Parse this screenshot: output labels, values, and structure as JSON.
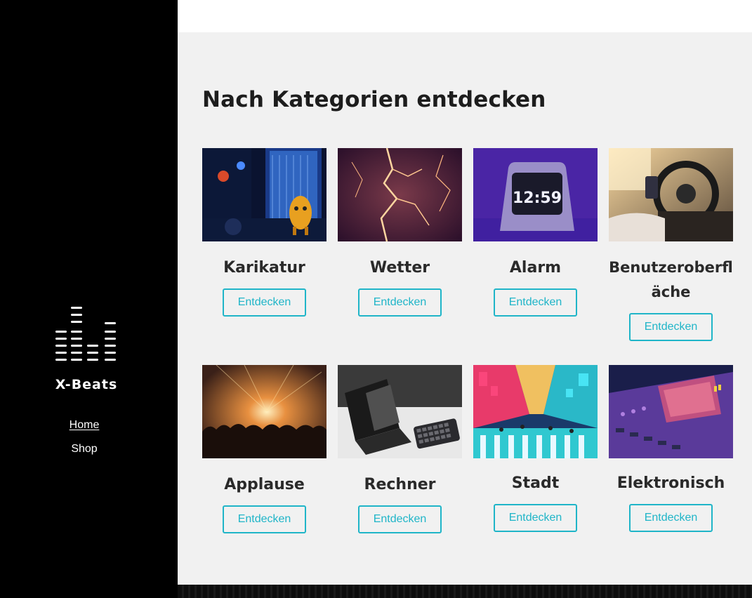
{
  "sidebar": {
    "brand": "X-Beats",
    "nav": [
      {
        "label": "Home",
        "active": true
      },
      {
        "label": "Shop",
        "active": false
      }
    ]
  },
  "main": {
    "title": "Nach Kategorien entdecken",
    "categories": [
      {
        "label": "Karikatur",
        "button": "Entdecken"
      },
      {
        "label": "Wetter",
        "button": "Entdecken"
      },
      {
        "label": "Alarm",
        "button": "Entdecken",
        "clock_text": "12:59"
      },
      {
        "label": "Benutzeroberfläche",
        "button": "Entdecken"
      },
      {
        "label": "Applause",
        "button": "Entdecken"
      },
      {
        "label": "Rechner",
        "button": "Entdecken"
      },
      {
        "label": "Stadt",
        "button": "Entdecken"
      },
      {
        "label": "Elektronisch",
        "button": "Entdecken"
      }
    ]
  },
  "colors": {
    "accent": "#1fb5c8",
    "sidebar_bg": "#000000",
    "content_bg": "#f1f1f1"
  }
}
